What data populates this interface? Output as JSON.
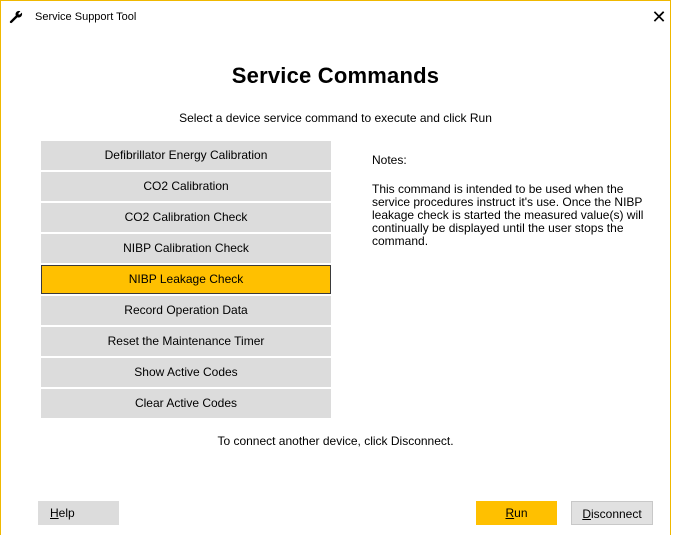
{
  "window": {
    "title": "Service Support Tool",
    "close_glyph": "✕",
    "icon": "wrench-icon"
  },
  "main": {
    "heading": "Service Commands",
    "instruction": "Select a device service command to execute and click Run",
    "commands": [
      {
        "label": "Defibrillator Energy Calibration",
        "selected": false
      },
      {
        "label": "CO2 Calibration",
        "selected": false
      },
      {
        "label": "CO2 Calibration Check",
        "selected": false
      },
      {
        "label": "NIBP Calibration Check",
        "selected": false
      },
      {
        "label": "NIBP Leakage Check",
        "selected": true
      },
      {
        "label": "Record Operation Data",
        "selected": false
      },
      {
        "label": "Reset the Maintenance Timer",
        "selected": false
      },
      {
        "label": "Show Active Codes",
        "selected": false
      },
      {
        "label": "Clear Active Codes",
        "selected": false
      }
    ],
    "notes_label": "Notes:",
    "notes_text": "This command is intended to be used when the service procedures instruct it's use. Once the NIBP leakage check is started the measured value(s) will continually be displayed until the user stops the command.",
    "footer": "To connect another device, click Disconnect."
  },
  "buttons": {
    "help": {
      "label": "Help",
      "mnemonic": "H",
      "rest": "elp"
    },
    "run": {
      "label": "Run",
      "mnemonic": "R",
      "rest": "un"
    },
    "disconnect": {
      "label": "Disconnect",
      "mnemonic": "D",
      "rest": "isconnect"
    }
  },
  "colors": {
    "accent": "#ffc000",
    "button_gray": "#dcdcdc",
    "window_border": "#f0b800"
  }
}
